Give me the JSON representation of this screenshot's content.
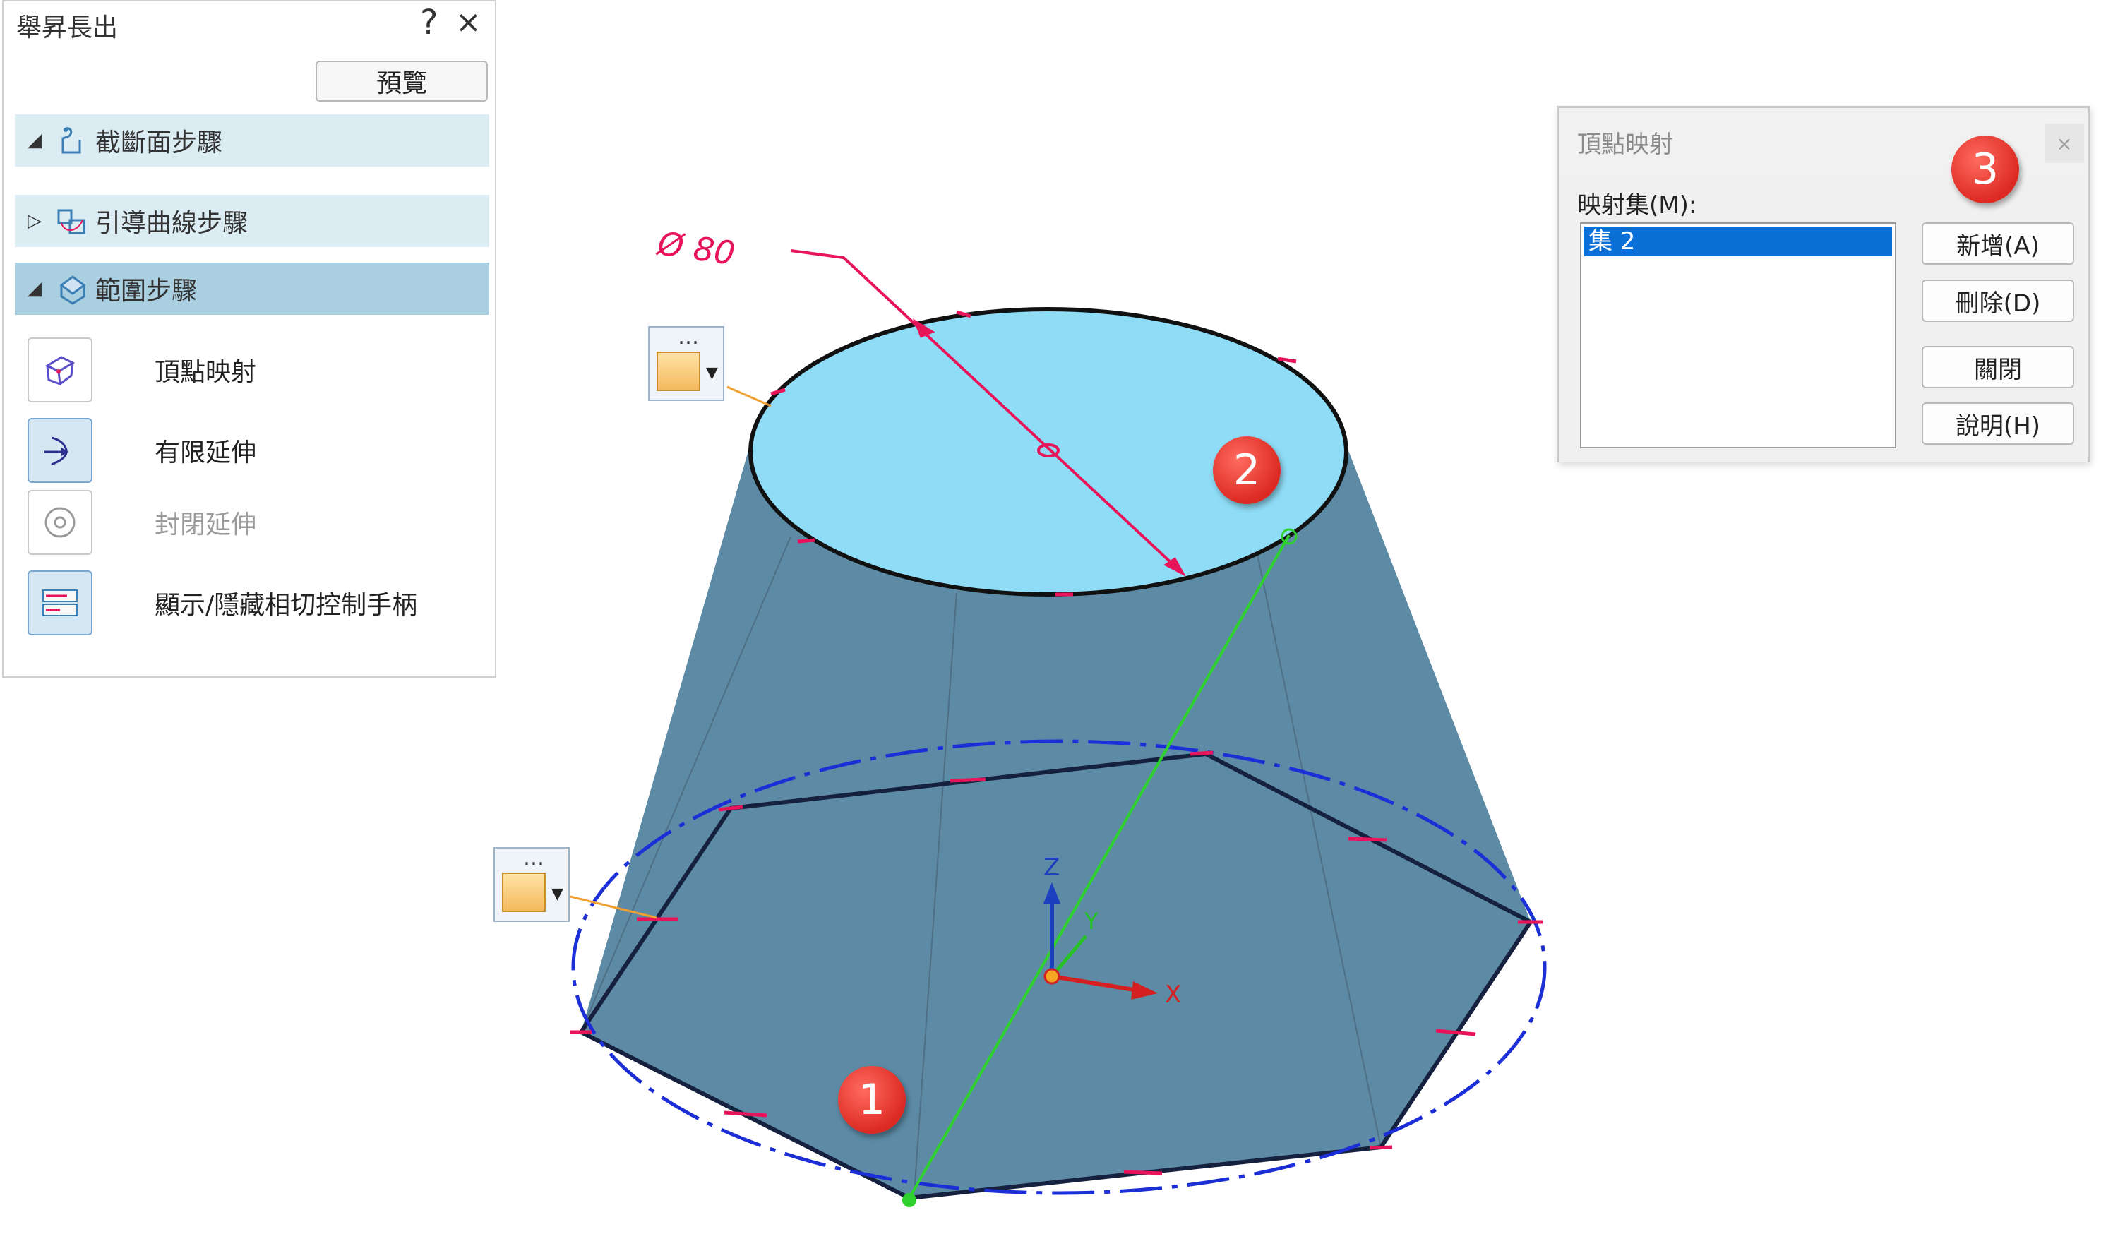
{
  "panel": {
    "title": "舉昇長出",
    "help": "?",
    "close": "×",
    "preview": "預覽",
    "steps": [
      {
        "label": "截斷面步驟",
        "expanded": true
      },
      {
        "label": "引導曲線步驟",
        "expanded": false
      },
      {
        "label": "範圍步驟",
        "expanded": true
      }
    ],
    "tools": [
      {
        "label": "頂點映射",
        "icon": "vertex-mapping-icon",
        "selected": false,
        "enabled": true
      },
      {
        "label": "有限延伸",
        "icon": "finite-extent-icon",
        "selected": true,
        "enabled": true
      },
      {
        "label": "封閉延伸",
        "icon": "closed-extent-icon",
        "selected": false,
        "enabled": false
      },
      {
        "label": "顯示/隱藏相切控制手柄",
        "icon": "tangent-handle-icon",
        "selected": false,
        "enabled": true
      }
    ]
  },
  "dialog": {
    "title": "頂點映射",
    "close": "×",
    "map_label": "映射集(M):",
    "items": [
      "集 2"
    ],
    "buttons": {
      "add": "新增(A)",
      "delete": "刪除(D)",
      "close": "關閉",
      "help": "說明(H)"
    }
  },
  "model": {
    "dimension": "Ø 80",
    "axes": {
      "x": "X",
      "y": "Y",
      "z": "Z"
    },
    "top_fill": "#8fdcf6",
    "side_fill": "#5c8aa3",
    "dim_color": "#e8145a",
    "path_color": "#2fd12f",
    "ellipse_color": "#1c2fd6"
  },
  "badges": {
    "one": "1",
    "two": "2",
    "three": "3"
  }
}
